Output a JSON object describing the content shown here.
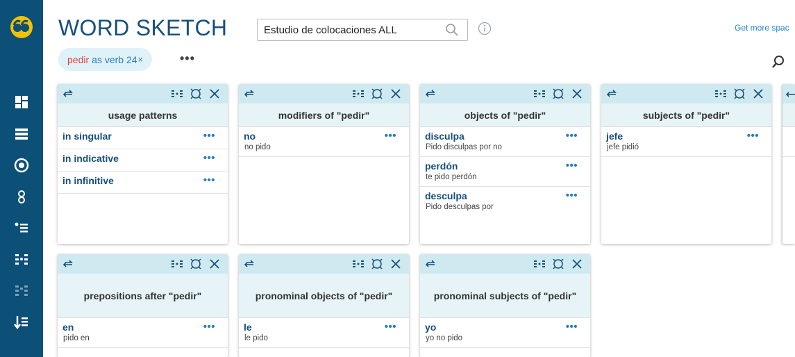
{
  "header": {
    "title": "WORD SKETCH",
    "corpus": "Estudio de colocaciones ALL",
    "more_space": "Get more spac"
  },
  "chip": {
    "lemma": "pedir",
    "label": "as verb 24",
    "close": "×"
  },
  "chip_more": "•••",
  "colors": {
    "sidebar": "#0c4f77",
    "toolbar": "#cfe9f1",
    "title_bg": "#e6f4f8",
    "accent": "#2a7ec0",
    "lemma": "#e2403b"
  },
  "sidebar_icons": [
    "app-logo",
    "dashboard-icon",
    "list-icon",
    "target-icon",
    "connection-icon",
    "bullet-list-icon",
    "word-sketch-icon",
    "difference-icon",
    "sort-icon"
  ],
  "cards": {
    "c1": {
      "title": "usage patterns",
      "rows": [
        {
          "w": "in singular"
        },
        {
          "w": "in indicative"
        },
        {
          "w": "in infinitive"
        }
      ]
    },
    "c2": {
      "title": "modifiers of \"pedir\"",
      "rows": [
        {
          "w": "no",
          "ex": "no pido"
        }
      ]
    },
    "c3": {
      "title": "objects of \"pedir\"",
      "rows": [
        {
          "w": "disculpa",
          "ex": "Pido disculpas por no"
        },
        {
          "w": "perdón",
          "ex": "te pido perdón"
        },
        {
          "w": "desculpa",
          "ex": "Pido desculpas por"
        }
      ]
    },
    "c4": {
      "title": "subjects of \"pedir\"",
      "rows": [
        {
          "w": "jefe",
          "ex": "jefe pidió"
        }
      ]
    },
    "c5": {
      "title": "prepositions after \"pedir\"",
      "rows": [
        {
          "w": "en",
          "ex": "pido en"
        }
      ]
    },
    "c6": {
      "title": "pronominal objects of \"pedir\"",
      "rows": [
        {
          "w": "le",
          "ex": "le pido"
        }
      ]
    },
    "c7": {
      "title": "pronominal subjects of \"pedir\"",
      "rows": [
        {
          "w": "yo",
          "ex": "yo no pido"
        }
      ]
    }
  },
  "row_more": "•••"
}
